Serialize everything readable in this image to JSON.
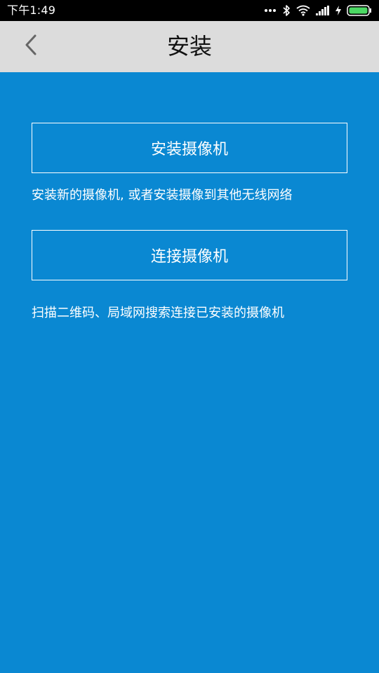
{
  "status_bar": {
    "time": "下午1:49",
    "icons": [
      "more-dots-icon",
      "bluetooth-icon",
      "wifi-icon",
      "signal-icon",
      "charging-icon",
      "battery-icon"
    ]
  },
  "header": {
    "title": "安装",
    "back_icon": "chevron-left-icon"
  },
  "main": {
    "install_button_label": "安装摄像机",
    "install_description": "安装新的摄像机, 或者安装摄像到其他无线网络",
    "connect_button_label": "连接摄像机",
    "connect_description": "扫描二维码、局域网搜索连接已安装的摄像机"
  },
  "colors": {
    "background": "#0a88d2",
    "header_bg": "#dcdcdc",
    "status_bar_bg": "#000000",
    "battery_fill": "#4cd964"
  }
}
